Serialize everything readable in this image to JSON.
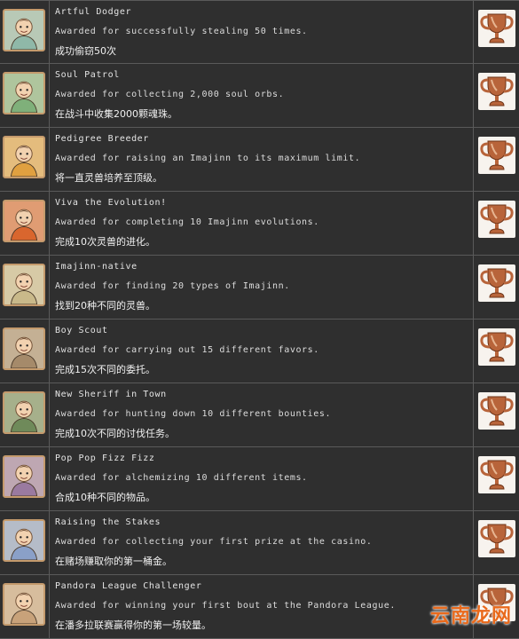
{
  "achievements": [
    {
      "title": "Artful Dodger",
      "description": "Awarded for successfully stealing 50 times.",
      "description_cn": "成功偷窃50次",
      "icon": "artful-dodger-icon",
      "trophy": "bronze-trophy-icon",
      "badge_color": "#8fb8a8"
    },
    {
      "title": "Soul Patrol",
      "description": "Awarded for collecting 2,000 soul orbs.",
      "description_cn": "在战斗中收集2000颗魂珠。",
      "icon": "soul-patrol-icon",
      "trophy": "bronze-trophy-icon",
      "badge_color": "#7fb07a"
    },
    {
      "title": "Pedigree Breeder",
      "description": "Awarded for raising an Imajinn to its maximum limit.",
      "description_cn": "将一直灵兽培养至顶级。",
      "icon": "pedigree-breeder-icon",
      "trophy": "bronze-trophy-icon",
      "badge_color": "#e0a040"
    },
    {
      "title": "Viva the Evolution!",
      "description": "Awarded for completing 10 Imajinn evolutions.",
      "description_cn": "完成10次灵兽的进化。",
      "icon": "viva-evolution-icon",
      "trophy": "bronze-trophy-icon",
      "badge_color": "#d9662e"
    },
    {
      "title": "Imajinn-native",
      "description": "Awarded for finding 20 types of Imajinn.",
      "description_cn": "找到20种不同的灵兽。",
      "icon": "imajinn-native-icon",
      "trophy": "bronze-trophy-icon",
      "badge_color": "#c9b98a"
    },
    {
      "title": "Boy Scout",
      "description": "Awarded for carrying out 15 different favors.",
      "description_cn": "完成15次不同的委托。",
      "icon": "boy-scout-icon",
      "trophy": "bronze-trophy-icon",
      "badge_color": "#a58a6a"
    },
    {
      "title": "New Sheriff in Town",
      "description": "Awarded for hunting down 10 different bounties.",
      "description_cn": "完成10次不同的讨伐任务。",
      "icon": "new-sheriff-icon",
      "trophy": "bronze-trophy-icon",
      "badge_color": "#6f8a5a"
    },
    {
      "title": "Pop Pop Fizz Fizz",
      "description": "Awarded for alchemizing 10 different items.",
      "description_cn": "合成10种不同的物品。",
      "icon": "pop-pop-fizz-icon",
      "trophy": "bronze-trophy-icon",
      "badge_color": "#9a7aa0"
    },
    {
      "title": "Raising the Stakes",
      "description": "Awarded for collecting your first prize at the casino.",
      "description_cn": "在赌场赚取你的第一桶金。",
      "icon": "raising-stakes-icon",
      "trophy": "bronze-trophy-icon",
      "badge_color": "#8aa0c8"
    },
    {
      "title": "Pandora League Challenger",
      "description": "Awarded for winning your first bout at the Pandora League.",
      "description_cn": "在潘多拉联赛赢得你的第一场较量。",
      "icon": "pandora-league-icon",
      "trophy": "bronze-trophy-icon",
      "badge_color": "#c8a27a"
    }
  ],
  "watermark": "云南龙网",
  "colors": {
    "background": "#2f2f2f",
    "border": "#5a5a5a",
    "trophy_bronze": "#b8643a",
    "watermark": "#e96a1c"
  }
}
